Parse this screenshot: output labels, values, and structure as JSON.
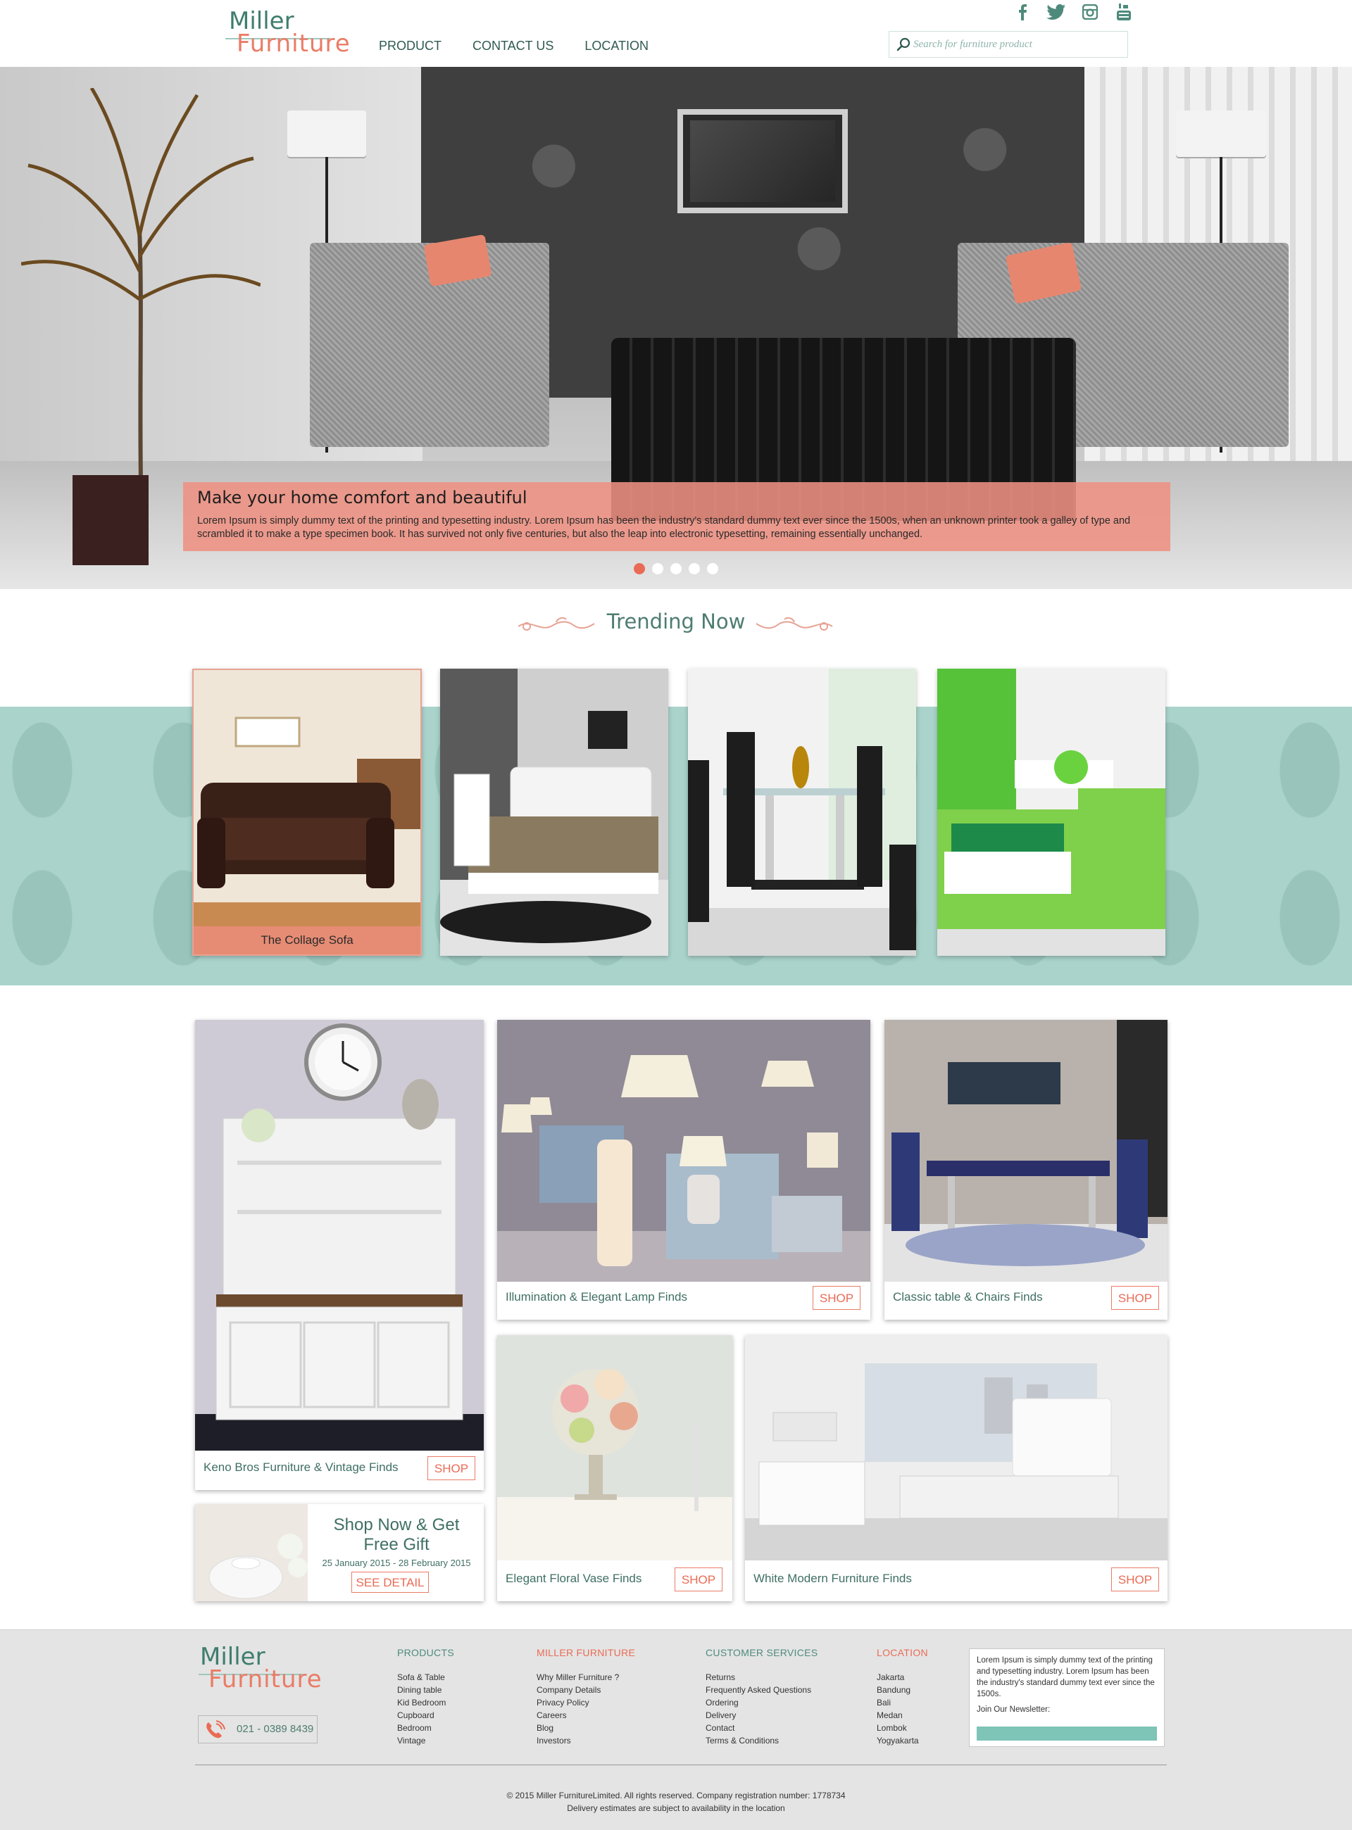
{
  "brand": {
    "line1": "Miller",
    "line2": "Furniture"
  },
  "nav": [
    {
      "label": "PRODUCT"
    },
    {
      "label": "CONTACT US"
    },
    {
      "label": "LOCATION"
    }
  ],
  "social": [
    "facebook-icon",
    "twitter-icon",
    "instagram-icon",
    "youtube-icon"
  ],
  "search": {
    "placeholder": "Search for furniture product"
  },
  "hero": {
    "title": "Make your home comfort and beautiful",
    "text": "Lorem Ipsum is simply dummy text of the printing and typesetting industry. Lorem Ipsum has been the industry's standard dummy text ever since the 1500s, when an unknown printer took a galley of type and scrambled it to make a type specimen book. It has survived not only five centuries, but also the leap into electronic typesetting, remaining essentially unchanged.",
    "slide_count": 5,
    "active_slide": 1
  },
  "trending": {
    "title": "Trending Now",
    "items": [
      {
        "label": "The Collage Sofa"
      },
      {
        "label": ""
      },
      {
        "label": ""
      },
      {
        "label": ""
      }
    ]
  },
  "finds": {
    "vintage": {
      "caption": "Keno Bros Furniture & Vintage Finds",
      "button": "SHOP"
    },
    "lamp": {
      "caption": "Illumination & Elegant Lamp Finds",
      "button": "SHOP"
    },
    "table": {
      "caption": "Classic table & Chairs Finds",
      "button": "SHOP"
    },
    "vase": {
      "caption": "Elegant Floral Vase Finds",
      "button": "SHOP"
    },
    "white": {
      "caption": "White Modern Furniture Finds",
      "button": "SHOP"
    }
  },
  "promo": {
    "title_line1": "Shop Now & Get",
    "title_line2": "Free Gift",
    "dates": "25 January 2015 - 28 February 2015",
    "button": "SEE DETAIL"
  },
  "footer": {
    "phone": "021 - 0389 8439",
    "columns": [
      {
        "title": "PRODUCTS",
        "color": "#4e8a7c",
        "items": [
          "Sofa & Table",
          "Dining table",
          "Kid Bedroom",
          "Cupboard",
          "Bedroom",
          "Vintage"
        ]
      },
      {
        "title": "MILLER FURNITURE",
        "color": "#ea6b55",
        "items": [
          "Why Miller Furniture ?",
          "Company Details",
          "Privacy Policy",
          "Careers",
          "Blog",
          "Investors"
        ]
      },
      {
        "title": "CUSTOMER SERVICES",
        "color": "#4e8a7c",
        "items": [
          "Returns",
          "Frequently Asked Questions",
          "Ordering",
          "Delivery",
          "Contact",
          "Terms & Conditions"
        ]
      },
      {
        "title": "LOCATION",
        "color": "#ea6b55",
        "items": [
          "Jakarta",
          "Bandung",
          "Bali",
          "Medan",
          "Lombok",
          "Yogyakarta"
        ]
      }
    ],
    "newsletter": {
      "text": "Lorem Ipsum is simply dummy text of the printing and typesetting industry. Lorem Ipsum has been the industry's standard dummy text ever since the 1500s.",
      "label": "Join Our Newsletter:"
    },
    "copyright_line1": "© 2015 Miller FurnitureLimited. All rights reserved. Company registration number: 1778734",
    "copyright_line2": "Delivery estimates are subject to availability in the location"
  }
}
